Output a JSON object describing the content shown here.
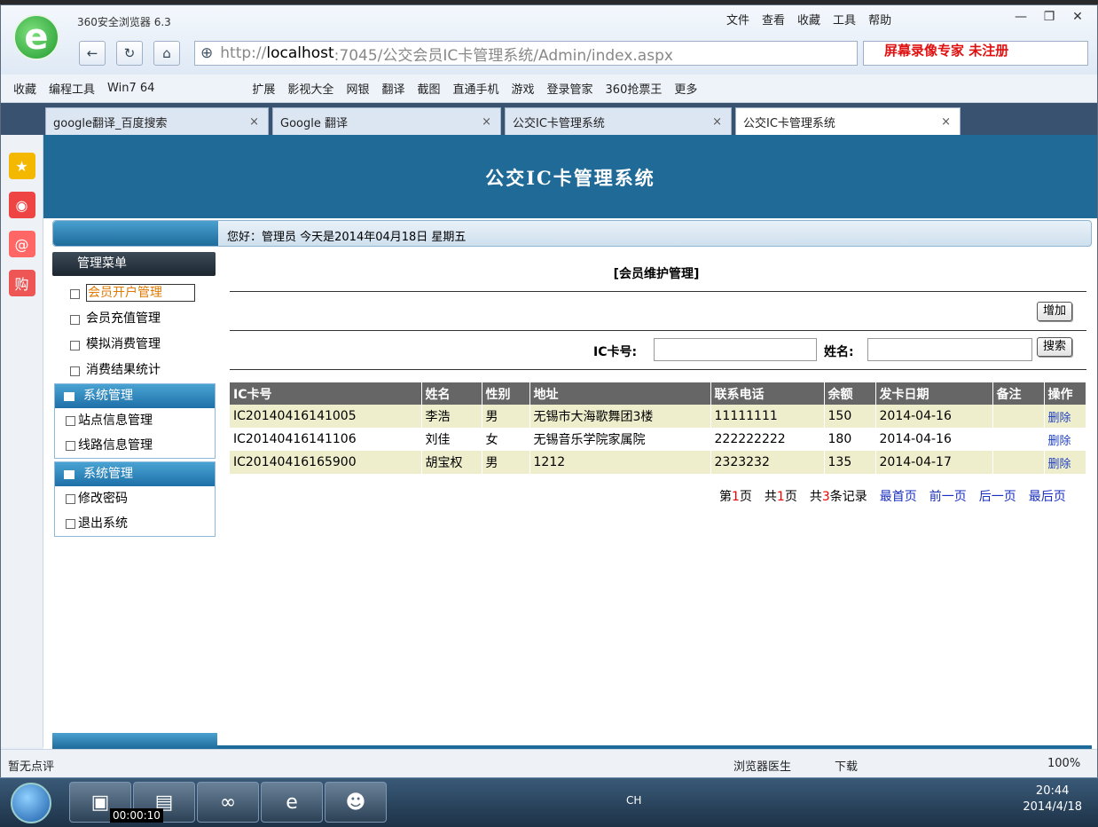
{
  "browser": {
    "app_title": "360安全浏览器 6.3",
    "menu": [
      "文件",
      "查看",
      "收藏",
      "工具",
      "帮助"
    ],
    "url_prefix": "http://",
    "url_host": "localhost",
    "url_rest": ":7045/公交会员IC卡管理系统/Admin/index.aspx",
    "watermark": "屏幕录像专家 未注册",
    "bookmarks": [
      "收藏",
      "编程工具",
      "Win7 64",
      "扩展",
      "影视大全",
      "网银",
      "翻译",
      "截图",
      "直通手机",
      "游戏",
      "登录管家",
      "360抢票王",
      "更多"
    ],
    "tabs": [
      "google翻译_百度搜索",
      "Google 翻译",
      "公交IC卡管理系统",
      "公交IC卡管理系统"
    ]
  },
  "page": {
    "banner_title": "公交IC卡管理系统",
    "greeting": "您好：管理员   今天是2014年04月18日  星期五",
    "menu_head": "管理菜单",
    "menu_items": [
      "会员开户管理",
      "会员充值管理",
      "模拟消费管理",
      "消费结果统计"
    ],
    "group1_title": "系统管理",
    "group1_items": [
      "站点信息管理",
      "线路信息管理"
    ],
    "group2_title": "系统管理",
    "group2_items": [
      "修改密码",
      "退出系统"
    ],
    "section_title": "[会员维护管理]",
    "add_button": "增加",
    "card_label": "IC卡号:",
    "name_label": "姓名:",
    "search_button": "搜索",
    "columns": [
      "IC卡号",
      "姓名",
      "性别",
      "地址",
      "联系电话",
      "余额",
      "发卡日期",
      "备注",
      "操作"
    ],
    "rows": [
      [
        "IC20140416141005",
        "李浩",
        "男",
        "无锡市大海歌舞团3楼",
        "11111111",
        "150",
        "2014-04-16",
        "",
        "删除"
      ],
      [
        "IC20140416141106",
        "刘佳",
        "女",
        "无锡音乐学院家属院",
        "222222222",
        "180",
        "2014-04-16",
        "",
        "删除"
      ],
      [
        "IC20140416165900",
        "胡宝权",
        "男",
        "1212",
        "2323232",
        "135",
        "2014-04-17",
        "",
        "删除"
      ]
    ],
    "pager": {
      "page_prefix": "第",
      "page_num": "1",
      "page_suffix": "页",
      "total_prefix": "共",
      "total_num": "1",
      "total_suffix": "页",
      "rec_prefix": "共",
      "rec_num": "3",
      "rec_suffix": "条记录",
      "first": "最首页",
      "prev": "前一页",
      "next": "后一页",
      "last": "最后页"
    }
  },
  "statusbar": {
    "left": "暂无点评",
    "doctor": "浏览器医生",
    "download": "下载",
    "zoom": "100%"
  },
  "taskbar": {
    "timer": "00:00:10",
    "ime": "CH",
    "time": "20:44",
    "date": "2014/4/18"
  }
}
